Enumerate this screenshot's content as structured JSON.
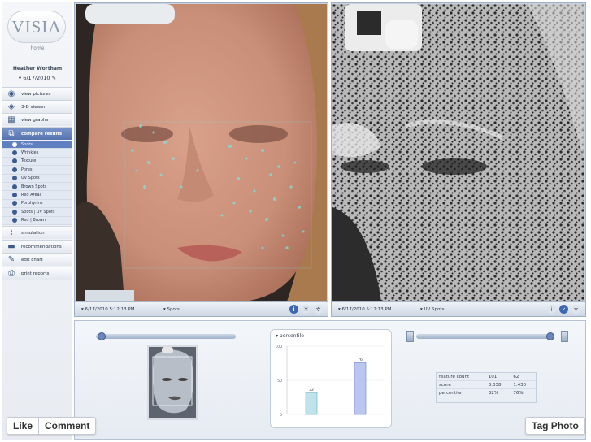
{
  "sidebar": {
    "logo": "VISIA",
    "home": "home",
    "patient_name": "Heather Wortham",
    "patient_date": "6/17/2010",
    "nav": [
      {
        "label": "view pictures",
        "icon": "camera-icon"
      },
      {
        "label": "3-D viewer",
        "icon": "cube-icon"
      },
      {
        "label": "view graphs",
        "icon": "graph-icon"
      },
      {
        "label": "compare results",
        "icon": "compare-icon"
      }
    ],
    "sub_items": [
      "Spots",
      "Wrinkles",
      "Texture",
      "Pores",
      "UV Spots",
      "Brown Spots",
      "Red Areas",
      "Porphyrins",
      "Spots | UV Spots",
      "Red | Brown"
    ],
    "nav_bottom": [
      {
        "label": "simulation",
        "icon": "simulation-icon"
      },
      {
        "label": "recommendations",
        "icon": "recommendations-icon"
      },
      {
        "label": "edit chart",
        "icon": "edit-icon"
      },
      {
        "label": "print reports",
        "icon": "printer-icon"
      }
    ]
  },
  "left_panel": {
    "date": "6/17/2010 5:12:13 PM",
    "mode": "Spots"
  },
  "right_panel": {
    "date": "6/17/2010 5:12:13 PM",
    "mode": "UV Spots"
  },
  "chart_data": {
    "type": "bar",
    "title": "percentile",
    "categories": [
      "Spots",
      "UV Spots"
    ],
    "values": [
      32,
      76
    ],
    "ylim": [
      0,
      100
    ],
    "yticks": [
      "100",
      "50",
      "0"
    ],
    "data_labels": [
      "32",
      "76"
    ]
  },
  "stats": {
    "rows": [
      {
        "label": "feature count",
        "a": "101",
        "b": "62"
      },
      {
        "label": "score",
        "a": "3.038",
        "b": "1.430"
      },
      {
        "label": "percentile",
        "a": "32%",
        "b": "76%"
      }
    ]
  },
  "facebook": {
    "like": "Like",
    "comment": "Comment",
    "tag": "Tag Photo"
  },
  "colors": {
    "accent": "#5f7fc0",
    "panel_bar": "#cdd7e4",
    "bar_fill": "#b9d6ef"
  }
}
